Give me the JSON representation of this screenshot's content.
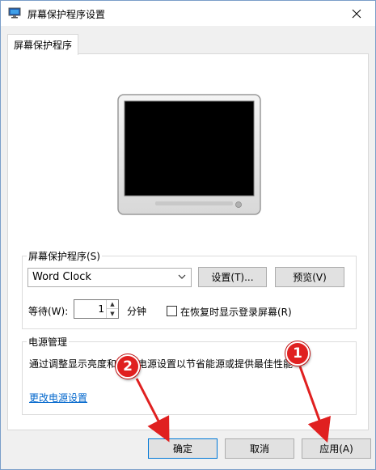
{
  "window": {
    "title": "屏幕保护程序设置"
  },
  "tab": {
    "label": "屏幕保护程序"
  },
  "screensaver": {
    "group_label": "屏幕保护程序(S)",
    "selected": "Word Clock",
    "settings_button": "设置(T)...",
    "preview_button": "预览(V)",
    "wait_label": "等待(W):",
    "wait_value": "1",
    "wait_unit": "分钟",
    "resume_label": "在恢复时显示登录屏幕(R)",
    "resume_checked": false
  },
  "power": {
    "group_label": "电源管理",
    "description_left": "通过调整显示亮度和",
    "description_right": "电源设置以节省能源或提供最佳性能",
    "link": "更改电源设置"
  },
  "buttons": {
    "ok": "确定",
    "cancel": "取消",
    "apply": "应用(A)"
  },
  "annotations": {
    "badge_1": "1",
    "badge_2": "2",
    "color": "#e02020"
  }
}
